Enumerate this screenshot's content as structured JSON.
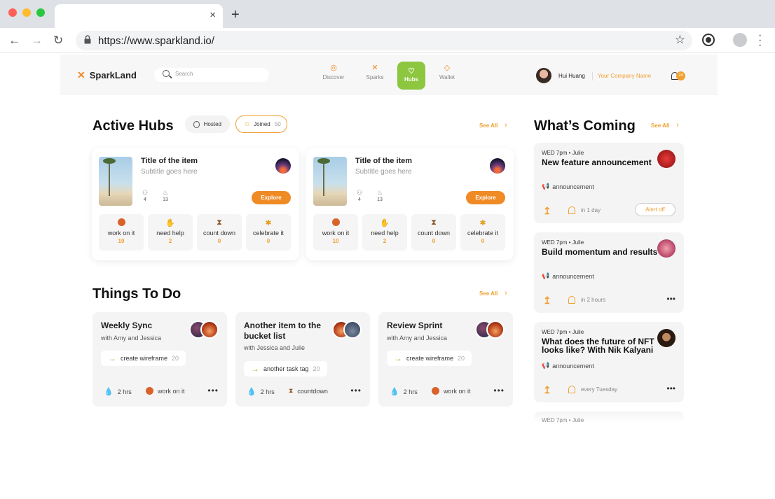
{
  "browser": {
    "url": "https://www.sparkland.io/",
    "tab_close": "×",
    "new_tab": "+"
  },
  "app": {
    "logo": "SparkLand",
    "search_placeholder": "Search",
    "nav": [
      {
        "label": "Discover",
        "icon": "compass-icon"
      },
      {
        "label": "Sparks",
        "icon": "sparks-icon"
      },
      {
        "label": "Hubs",
        "icon": "hubs-icon",
        "active": true
      },
      {
        "label": "Wallet",
        "icon": "wallet-icon"
      }
    ],
    "user_name": "Hui Huang",
    "company": "Your Company Name",
    "notification_count": "24"
  },
  "active_hubs": {
    "title": "Active Hubs",
    "hosted_label": "Hosted",
    "joined_label": "Joined",
    "joined_count": "50",
    "see_all": "See All",
    "cards": [
      {
        "title": "Title of the item",
        "subtitle": "Subtitle goes here",
        "members": "4",
        "sparks": "13",
        "explore": "Explore",
        "actions": [
          {
            "label": "work on it",
            "count": "10",
            "icon": "basketball-icon"
          },
          {
            "label": "need help",
            "count": "2",
            "icon": "raised-hand-icon"
          },
          {
            "label": "count down",
            "count": "0",
            "icon": "hourglass-icon"
          },
          {
            "label": "celebrate it",
            "count": "0",
            "icon": "party-popper-icon"
          }
        ]
      },
      {
        "title": "Title of the item",
        "subtitle": "Subtitle goes here",
        "members": "4",
        "sparks": "13",
        "explore": "Explore",
        "actions": [
          {
            "label": "work on it",
            "count": "10",
            "icon": "basketball-icon"
          },
          {
            "label": "need help",
            "count": "2",
            "icon": "raised-hand-icon"
          },
          {
            "label": "count down",
            "count": "0",
            "icon": "hourglass-icon"
          },
          {
            "label": "celebrate it",
            "count": "0",
            "icon": "party-popper-icon"
          }
        ]
      }
    ]
  },
  "things_to_do": {
    "title": "Things To Do",
    "see_all": "See All",
    "cards": [
      {
        "title": "Weekly Sync",
        "subtitle": "with Amy and Jessica",
        "tag": "create wireframe",
        "tag_count": "20",
        "duration": "2 hrs",
        "status": "work on it"
      },
      {
        "title": "Another item to the bucket list",
        "subtitle": "with Jessica and Julie",
        "tag": "another task tag",
        "tag_count": "20",
        "duration": "2 hrs",
        "status": "countdown"
      },
      {
        "title": "Review Sprint",
        "subtitle": "with Amy and Jessica",
        "tag": "create wireframe",
        "tag_count": "20",
        "duration": "2 hrs",
        "status": "work on it"
      }
    ]
  },
  "whats_coming": {
    "title": "What’s Coming",
    "see_all": "See All",
    "items": [
      {
        "time": "WED 7pm • Julie",
        "title": "New feature announcement",
        "type": "announcement",
        "when": "in 1 day",
        "action": "Alert off"
      },
      {
        "time": "WED 7pm • Julie",
        "title": "Build momentum and results",
        "type": "announcement",
        "when": "in 2 hours"
      },
      {
        "time": "WED 7pm • Julie",
        "title": "What does the future of NFT looks like? With Nik Kalyani",
        "type": "announcement",
        "when": "every Tuesday"
      }
    ],
    "partial_time": "WED 7pm • Julie"
  },
  "colors": {
    "accent": "#f08a24",
    "hub_active": "#8dc63f",
    "link": "#f0a030"
  }
}
